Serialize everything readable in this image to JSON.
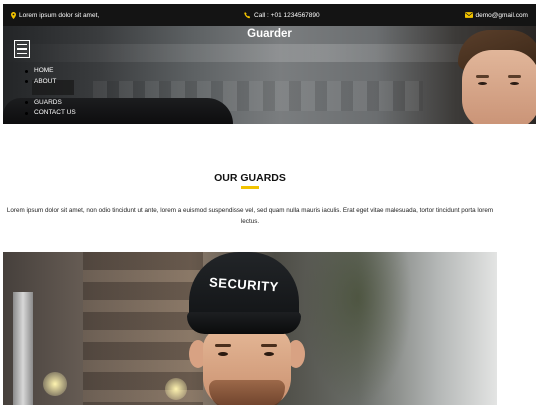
{
  "topbar": {
    "address": "Lorem ipsum dolor sit amet,",
    "phone": "Call : +01 1234567890",
    "email": "demo@gmail.com"
  },
  "header": {
    "brand": "Guarder",
    "menu": [
      {
        "label": "HOME"
      },
      {
        "label": "ABOUT"
      },
      {
        "label": "GUARDS"
      },
      {
        "label": "CONTACT US"
      }
    ]
  },
  "section": {
    "title": "OUR GUARDS",
    "text": "Lorem ipsum dolor sit amet, non odio tincidunt ut ante, lorem a euismod suspendisse vel, sed quam nulla mauris iaculis. Erat eget vitae malesuada, tortor tincidunt porta lorem lectus.",
    "image_cap_text": "SECURITY"
  },
  "colors": {
    "accent": "#f2c300",
    "topbar_bg": "#141414"
  },
  "icons": {
    "address": "map-pin-icon",
    "phone": "phone-icon",
    "email": "envelope-icon",
    "menu": "hamburger-icon"
  }
}
